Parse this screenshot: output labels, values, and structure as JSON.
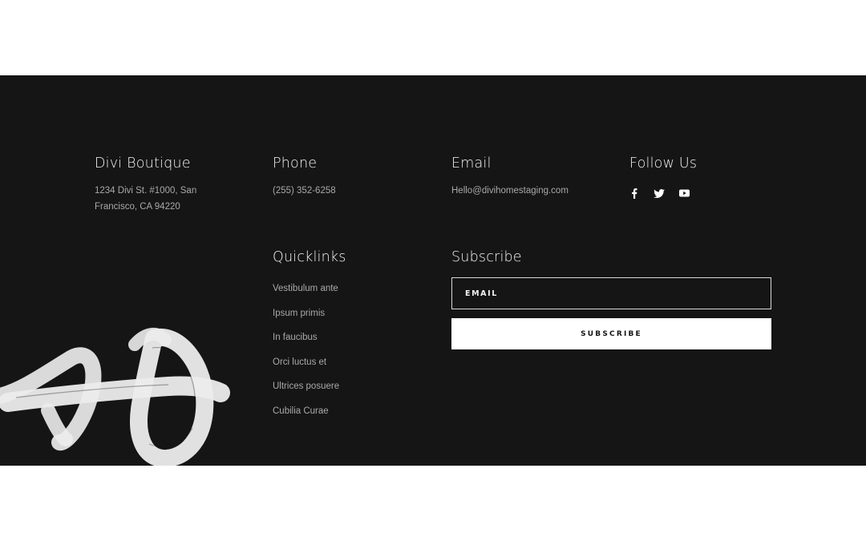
{
  "brand": {
    "heading": "Divi Boutique",
    "address_line1": "1234 Divi St. #1000, San",
    "address_line2": "Francisco, CA 94220"
  },
  "phone": {
    "heading": "Phone",
    "value": "(255) 352-6258"
  },
  "email": {
    "heading": "Email",
    "value": "Hello@divihomestaging.com"
  },
  "follow": {
    "heading": "Follow Us",
    "icons": [
      "facebook-icon",
      "twitter-icon",
      "youtube-icon"
    ]
  },
  "quicklinks": {
    "heading": "Quicklinks",
    "items": [
      "Vestibulum ante",
      "Ipsum primis",
      "In faucibus",
      "Orci luctus et",
      "Ultrices posuere",
      "Cubilia Curae"
    ]
  },
  "subscribe": {
    "heading": "Subscribe",
    "email_placeholder": "EMAIL",
    "button_label": "SUBSCRIBE"
  },
  "colors": {
    "footer_bg": "#151515",
    "heading": "#f2f2f2",
    "body_text": "#a9a9a9",
    "button_bg": "#ffffff"
  }
}
